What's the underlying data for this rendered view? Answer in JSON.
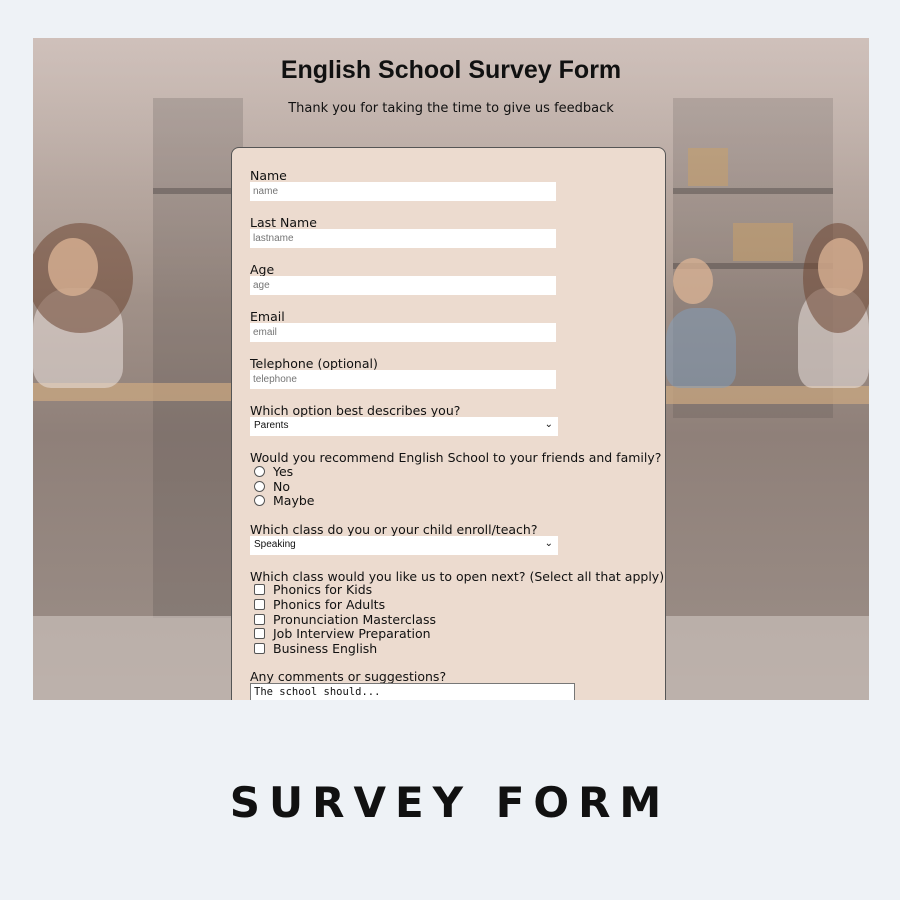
{
  "form": {
    "title": "English School Survey Form",
    "subtitle": "Thank you for taking the time to give us feedback",
    "fields": [
      {
        "label": "Name",
        "placeholder": "name"
      },
      {
        "label": "Last Name",
        "placeholder": "lastname"
      },
      {
        "label": "Age",
        "placeholder": "age"
      },
      {
        "label": "Email",
        "placeholder": "email"
      },
      {
        "label": "Telephone (optional)",
        "placeholder": "telephone"
      }
    ],
    "role": {
      "label": "Which option best describes you?",
      "selected": "Parents"
    },
    "recommend": {
      "question": "Would you recommend English School to your friends and family?",
      "options": [
        "Yes",
        "No",
        "Maybe"
      ]
    },
    "class_enrolled": {
      "label": "Which class do you or your child enroll/teach?",
      "selected": "Speaking"
    },
    "class_next": {
      "question": "Which class would you like us to open next? (Select all that apply)",
      "options": [
        "Phonics for Kids",
        "Phonics for Adults",
        "Pronunciation Masterclass",
        "Job Interview Preparation",
        "Business English"
      ]
    },
    "comments": {
      "label": "Any comments or suggestions?",
      "value": "The school should..."
    }
  },
  "caption": "SURVEY FORM",
  "colors": {
    "page_bg": "#eef2f6",
    "card_bg": "#ecdbcf",
    "text": "#111111"
  }
}
